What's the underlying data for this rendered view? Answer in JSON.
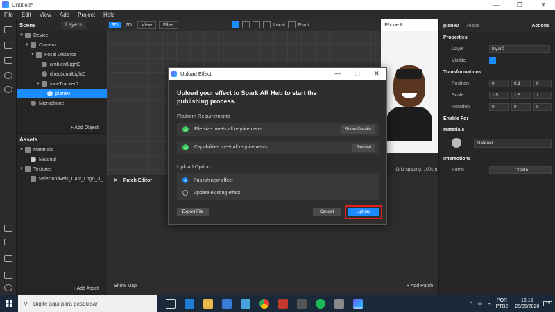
{
  "window": {
    "title": "Untitled*",
    "controls": [
      "—",
      "❐",
      "✕"
    ]
  },
  "menu": [
    "File",
    "Edit",
    "View",
    "Add",
    "Project",
    "Help"
  ],
  "scene": {
    "tab_scene": "Scene",
    "tab_layers": "Layers",
    "items": [
      "Device",
      "Camera",
      "Focal Distance",
      "ambientLight0",
      "directionalLight0",
      "faceTracker0",
      "plane0",
      "Microphone"
    ],
    "add_object": "+ Add Object"
  },
  "assets": {
    "title": "Assets",
    "items": [
      "Materials",
      "Material",
      "Textures",
      "Selecionáveis_Cast_Logo_3_..."
    ],
    "add_asset": "+ Add Asset"
  },
  "viewport": {
    "btn_3d": "3D",
    "btn_2d": "2D",
    "view": "View",
    "filter": "Filter",
    "local": "Local",
    "pivot": "Pivot"
  },
  "preview": {
    "device": "iPhone 8",
    "grid_spacing": "Grid spacing: 100cm"
  },
  "properties": {
    "object": "plane0",
    "type": "– Plane",
    "actions": "Actions",
    "properties": "Properties",
    "layer_label": "Layer",
    "layer_value": "layer0",
    "visible_label": "Visible",
    "transformations": "Transformations",
    "position_label": "Position",
    "position": [
      "0",
      "0,1",
      "0"
    ],
    "scale_label": "Scale",
    "scale": [
      "1,5",
      "1,5",
      "1"
    ],
    "rotation_label": "Rotation",
    "rotation": [
      "0",
      "0",
      "0"
    ],
    "enable_for": "Enable For",
    "materials": "Materials",
    "material_value": "Material",
    "interactions": "Interactions",
    "patch_label": "Patch",
    "create": "Create"
  },
  "patch_editor": {
    "title": "Patch Editor",
    "show_map": "Show Map",
    "add_patch": "+ Add Patch"
  },
  "dialog": {
    "title": "Upload Effect",
    "heading": "Upload your effect to Spark AR Hub to start the publishing process.",
    "platform_requirements": "Platform Requirements",
    "req1": "File size meets all requirements",
    "req1_btn": "Show Details",
    "req2": "Capabilities meet all requirements",
    "req2_btn": "Review",
    "upload_option": "Upload Option",
    "opt1": "Publish new effect",
    "opt2": "Update existing effect",
    "export_file": "Export File",
    "cancel": "Cancel",
    "upload": "Upload"
  },
  "taskbar": {
    "search_placeholder": "Digite aqui para pesquisar",
    "lang": "POR",
    "lang2": "PTB2",
    "time": "16:15",
    "date": "28/05/2020",
    "notif": "15"
  },
  "colors": {
    "accent": "#1a8cff",
    "success": "#36c95a",
    "highlight": "#e02020"
  }
}
